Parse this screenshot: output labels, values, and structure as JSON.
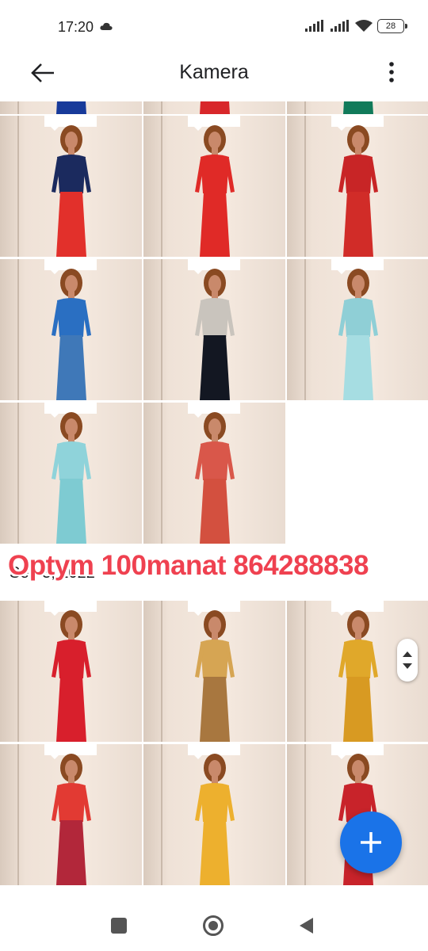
{
  "status_bar": {
    "time": "17:20",
    "battery": "28",
    "weather_icon": "cloud-icon",
    "signal_icons": [
      "signal-icon",
      "signal-icon",
      "wifi-icon"
    ]
  },
  "app_bar": {
    "title": "Kamera",
    "back_icon": "arrow-left-icon",
    "more_icon": "more-vert-icon"
  },
  "section": {
    "date_label": "Sep 3, 2022",
    "overlay_text": "Optym 100manat 864288838"
  },
  "photos": [
    {
      "top": "#173a9a",
      "bottom": "#173a9a"
    },
    {
      "top": "#d8272a",
      "bottom": "#d8272a"
    },
    {
      "top": "#117a5a",
      "bottom": "#117a5a"
    },
    {
      "top": "#1b2a5e",
      "bottom": "#e2302b"
    },
    {
      "top": "#e02a27",
      "bottom": "#e02a27"
    },
    {
      "top": "#c82526",
      "bottom": "#d12c28"
    },
    {
      "top": "#2a6fc2",
      "bottom": "#3f78b8"
    },
    {
      "top": "#c9c4bd",
      "bottom": "#131722"
    },
    {
      "top": "#8fcfd6",
      "bottom": "#a6dde2"
    },
    {
      "top": "#8fd3da",
      "bottom": "#7ecbd2"
    },
    {
      "top": "#d9574a",
      "bottom": "#d3503f"
    },
    {
      "top": "#d81f2c",
      "bottom": "#d81f2c"
    },
    {
      "top": "#d6a553",
      "bottom": "#a8773f"
    },
    {
      "top": "#e0a82a",
      "bottom": "#d89a22"
    },
    {
      "top": "#e23a33",
      "bottom": "#b2273a"
    },
    {
      "top": "#edb02e",
      "bottom": "#edb02e"
    },
    {
      "top": "#c8232a",
      "bottom": "#c8232a"
    }
  ],
  "fab": {
    "icon": "plus-icon",
    "color": "#1a73e8"
  },
  "nav_bar": {
    "recents_icon": "square-icon",
    "home_icon": "circle-icon",
    "back_icon": "triangle-back-icon"
  }
}
